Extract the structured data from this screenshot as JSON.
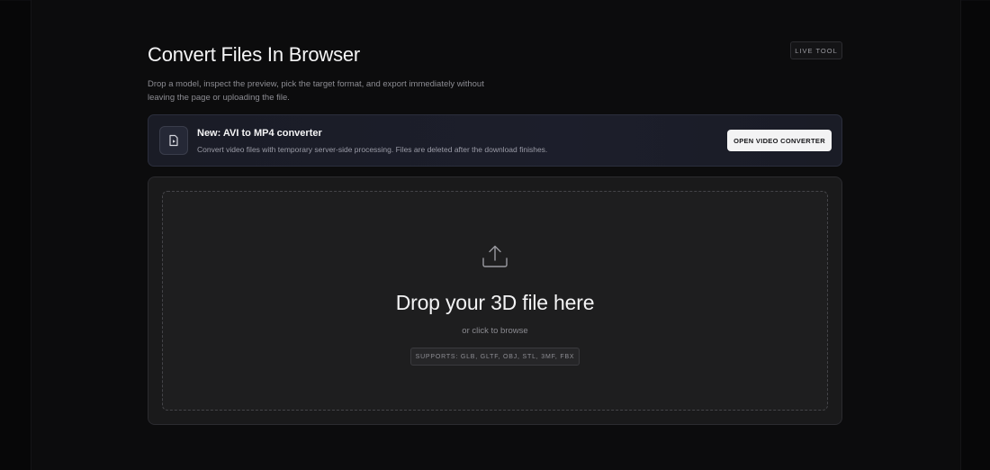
{
  "header": {
    "title": "Convert Files In Browser",
    "badge": "LIVE TOOL",
    "subtitle": "Drop a model, inspect the preview, pick the target format, and export immediately without leaving the page or uploading the file."
  },
  "promo": {
    "icon": "video-file-icon",
    "title": "New: AVI to MP4 converter",
    "description": "Convert video files with temporary server-side processing. Files are deleted after the download finishes.",
    "button_label": "OPEN VIDEO CONVERTER"
  },
  "dropzone": {
    "icon": "upload-icon",
    "heading": "Drop your 3D file here",
    "subtext": "or click to browse",
    "supports": "SUPPORTS: GLB, GLTF, OBJ, STL, 3MF, FBX"
  },
  "colors": {
    "background": "#0c0c0d",
    "promo_border": "#2b2e3c",
    "button_bg": "#f3f3f4"
  }
}
